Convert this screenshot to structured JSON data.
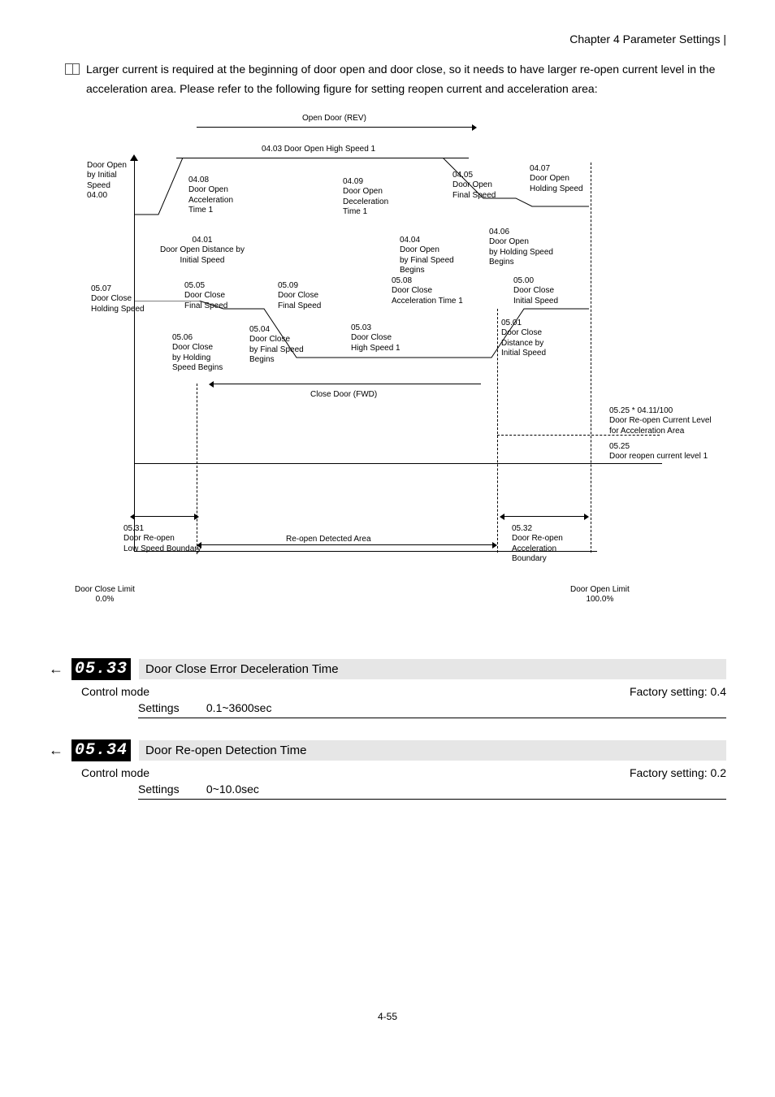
{
  "header": {
    "chapter": "Chapter 4 Parameter Settings |"
  },
  "intro": {
    "text": "Larger current is required at the beginning of door open and door close, so it needs to have larger re-open current level in the acceleration area. Please refer to the following figure for setting reopen current and acceleration area:"
  },
  "chart_data": {
    "type": "diagram",
    "title_top": "Open Door (REV)",
    "title_top2": "04.03  Door Open High Speed 1",
    "labels": {
      "y_axis": "Door Open\nby Initial\nSpeed\n04.00",
      "a04_08": "04.08\nDoor Open\nAcceleration\nTime 1",
      "a04_09": "04.09\nDoor Open\nDeceleration\nTime 1",
      "a04_05": "04.05\nDoor Open\nFinal Speed",
      "a04_07": "04.07\nDoor Open\nHolding Speed",
      "a04_01": "04.01\nDoor Open Distance by\nInitial Speed",
      "a04_04": "04.04\nDoor Open\nby Final Speed\nBegins",
      "a04_06": "04.06\nDoor Open\nby Holding Speed\nBegins",
      "a05_07": "05.07\nDoor Close\nHolding Speed",
      "a05_05": "05.05\nDoor Close\nFinal Speed",
      "a05_09": "05.09\nDoor Close\nFinal Speed",
      "a05_08": "05.08\nDoor Close\nAcceleration Time 1",
      "a05_00": "05.00\nDoor Close\nInitial Speed",
      "a05_06": "05.06\nDoor Close\nby Holding\nSpeed Begins",
      "a05_04": "05.04\nDoor Close\nby Final Speed\nBegins",
      "a05_03": "05.03\nDoor Close\nHigh Speed 1",
      "a05_01": "05.01\nDoor Close\nDistance by\nInitial Speed",
      "close_door": "Close Door (FWD)",
      "right_note_top": "05.25 * 04.11/100\nDoor Re-open Current Level\nfor Acceleration Area",
      "right_note_bot": "05.25\nDoor reopen current level 1",
      "a05_31": "05.31\nDoor Re-open\nLow Speed Boundary",
      "reopen_area": "Re-open Detected Area",
      "a05_32": "05.32\nDoor Re-open\nAcceleration\nBoundary",
      "left_limit": "Door Close Limit\n0.0%",
      "right_limit": "Door Open Limit\n100.0%"
    }
  },
  "params": [
    {
      "code": "05.33",
      "title": "Door Close Error Deceleration Time",
      "control_mode": "Control mode",
      "factory": "Factory setting: 0.4",
      "settings_label": "Settings",
      "settings_value": "0.1~3600sec"
    },
    {
      "code": "05.34",
      "title": "Door Re-open Detection Time",
      "control_mode": "Control mode",
      "factory": "Factory setting: 0.2",
      "settings_label": "Settings",
      "settings_value": "0~10.0sec"
    }
  ],
  "page_number": "4-55"
}
